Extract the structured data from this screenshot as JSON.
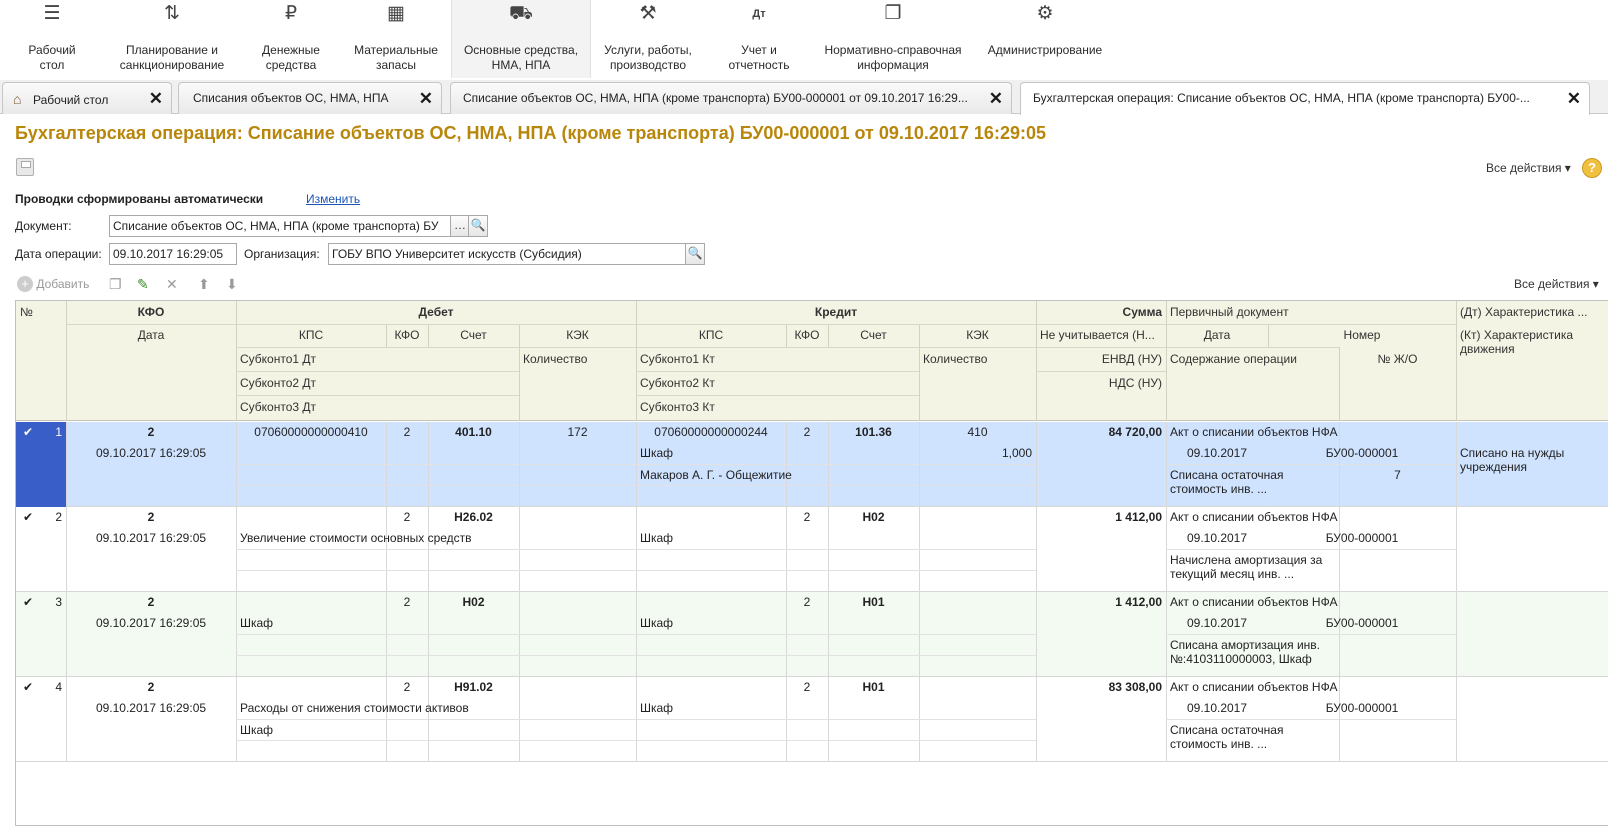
{
  "sections": [
    {
      "icon": "menu-icon",
      "glyph": "☰",
      "label1": "Рабочий",
      "label2": "стол"
    },
    {
      "icon": "planning-icon",
      "glyph": "⇅",
      "label1": "Планирование и",
      "label2": "санкционирование"
    },
    {
      "icon": "money-icon",
      "glyph": "₽",
      "label1": "Денежные",
      "label2": "средства"
    },
    {
      "icon": "materials-icon",
      "glyph": "▦",
      "label1": "Материальные",
      "label2": "запасы"
    },
    {
      "icon": "truck-icon",
      "glyph": "⛟",
      "label1": "Основные средства,",
      "label2": "НМА, НПА"
    },
    {
      "icon": "services-icon",
      "glyph": "⚒",
      "label1": "Услуги, работы,",
      "label2": "производство"
    },
    {
      "icon": "accounting-icon",
      "glyph": "Дт",
      "label1": "Учет и",
      "label2": "отчетность"
    },
    {
      "icon": "reference-icon",
      "glyph": "❐",
      "label1": "Нормативно-справочная",
      "label2": "информация"
    },
    {
      "icon": "gear-icon",
      "glyph": "⚙",
      "label1": "Администрирование",
      "label2": ""
    }
  ],
  "tabs": [
    {
      "label": "Рабочий стол"
    },
    {
      "label": "Списания объектов ОС, НМА, НПА"
    },
    {
      "label": "Списание объектов ОС, НМА, НПА (кроме транспорта) БУ00-000001 от 09.10.2017 16:29..."
    },
    {
      "label": "Бухгалтерская операция: Списание объектов ОС, НМА, НПА (кроме транспорта) БУ00-..."
    }
  ],
  "title": "Бухгалтерская операция: Списание объектов ОС, НМА, НПА (кроме транспорта) БУ00-000001 от 09.10.2017 16:29:05",
  "all_actions": "Все действия ▾",
  "help": "?",
  "auto_text": "Проводки сформированы автоматически",
  "change_link": "Изменить",
  "form": {
    "document_label": "Документ:",
    "document_value": "Списание объектов ОС, НМА, НПА (кроме транспорта) БУ",
    "date_label": "Дата операции:",
    "date_value": "09.10.2017 16:29:05",
    "org_label": "Организация:",
    "org_value": "ГОБУ ВПО Университет искусств (Субсидия)"
  },
  "toolbar": {
    "add": "Добавить"
  },
  "headers": {
    "num": "№",
    "kfo": "КФО",
    "date": "Дата",
    "debit": "Дебет",
    "credit": "Кредит",
    "kps": "КПС",
    "kfo2": "КФО",
    "account": "Счет",
    "kek": "КЭК",
    "sub1dt": "Субконто1 Дт",
    "sub2dt": "Субконто2 Дт",
    "sub3dt": "Субконто3 Дт",
    "qty": "Количество",
    "sub1kt": "Субконто1 Кт",
    "sub2kt": "Субконто2 Кт",
    "sub3kt": "Субконто3 Кт",
    "sum": "Сумма",
    "not_counted": "Не учитывается (Н...",
    "envd": "ЕНВД (НУ)",
    "nds": "НДС (НУ)",
    "primary": "Первичный документ",
    "pdate": "Дата",
    "pnum": "Номер",
    "content": "Содержание операции",
    "jo": "№ Ж/О",
    "char_dt": "(Дт) Характеристика ...",
    "char_kt": "(Кт) Характеристика движения"
  },
  "rows": [
    {
      "n": "1",
      "kfo": "2",
      "date": "09.10.2017 16:29:05",
      "d_kps": "07060000000000410",
      "d_kfo": "2",
      "d_acc": "401.10",
      "d_kek": "172",
      "d_s1": "",
      "d_s2": "",
      "d_qty": "",
      "c_kps": "07060000000000244",
      "c_kfo": "2",
      "c_acc": "101.36",
      "c_kek": "410",
      "c_s1": "Шкаф",
      "c_s2": "Макаров А. Г. - Общежитие",
      "c_qty": "1,000",
      "sum": "84 720,00",
      "doc": "Акт о списании объектов НФА",
      "pdate": "09.10.2017",
      "pnum": "БУ00-000001",
      "content": "Списана остаточная стоимость инв. ...",
      "jo": "7",
      "char": "Списано на нужды учреждения"
    },
    {
      "n": "2",
      "kfo": "2",
      "date": "09.10.2017 16:29:05",
      "d_kps": "",
      "d_kfo": "2",
      "d_acc": "Н26.02",
      "d_kek": "",
      "d_s1": "Увеличение стоимости основных средств",
      "d_s2": "",
      "d_qty": "",
      "c_kps": "",
      "c_kfo": "2",
      "c_acc": "Н02",
      "c_kek": "",
      "c_s1": "Шкаф",
      "c_s2": "",
      "c_qty": "",
      "sum": "1 412,00",
      "doc": "Акт о списании объектов НФА",
      "pdate": "09.10.2017",
      "pnum": "БУ00-000001",
      "content": "Начислена амортизация за текущий месяц инв. ...",
      "jo": "",
      "char": ""
    },
    {
      "n": "3",
      "kfo": "2",
      "date": "09.10.2017 16:29:05",
      "d_kps": "",
      "d_kfo": "2",
      "d_acc": "Н02",
      "d_kek": "",
      "d_s1": "Шкаф",
      "d_s2": "",
      "d_qty": "",
      "c_kps": "",
      "c_kfo": "2",
      "c_acc": "Н01",
      "c_kek": "",
      "c_s1": "Шкаф",
      "c_s2": "",
      "c_qty": "",
      "sum": "1 412,00",
      "doc": "Акт о списании объектов НФА",
      "pdate": "09.10.2017",
      "pnum": "БУ00-000001",
      "content": "Списана амортизация инв. №:4103110000003, Шкаф",
      "jo": "",
      "char": ""
    },
    {
      "n": "4",
      "kfo": "2",
      "date": "09.10.2017 16:29:05",
      "d_kps": "",
      "d_kfo": "2",
      "d_acc": "Н91.02",
      "d_kek": "",
      "d_s1": "Расходы от снижения стоимости активов",
      "d_s2": "Шкаф",
      "d_qty": "",
      "c_kps": "",
      "c_kfo": "2",
      "c_acc": "Н01",
      "c_kek": "",
      "c_s1": "Шкаф",
      "c_s2": "",
      "c_qty": "",
      "sum": "83 308,00",
      "doc": "Акт о списании объектов НФА",
      "pdate": "09.10.2017",
      "pnum": "БУ00-000001",
      "content": "Списана остаточная стоимость инв. ...",
      "jo": "",
      "char": ""
    }
  ]
}
